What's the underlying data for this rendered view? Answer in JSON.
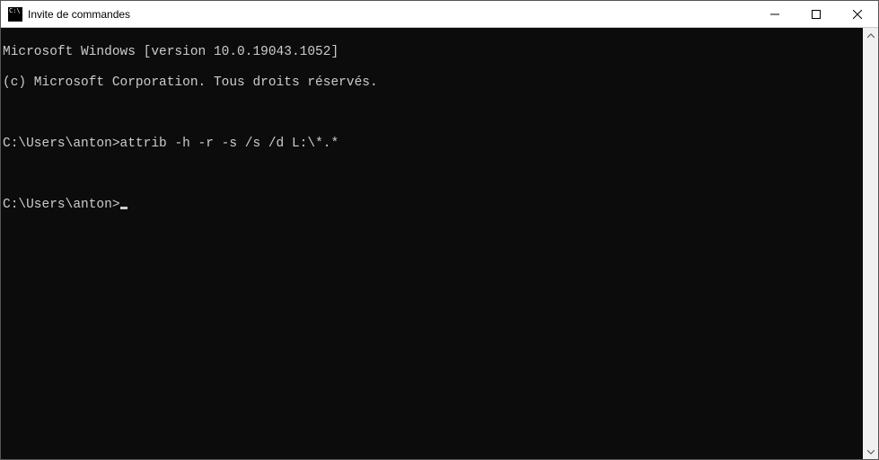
{
  "window": {
    "title": "Invite de commandes"
  },
  "console": {
    "line1": "Microsoft Windows [version 10.0.19043.1052]",
    "line2": "(c) Microsoft Corporation. Tous droits réservés.",
    "blank1": "",
    "prompt1": "C:\\Users\\anton>",
    "command1": "attrib -h -r -s /s /d L:\\*.*",
    "blank2": "",
    "prompt2": "C:\\Users\\anton>"
  }
}
